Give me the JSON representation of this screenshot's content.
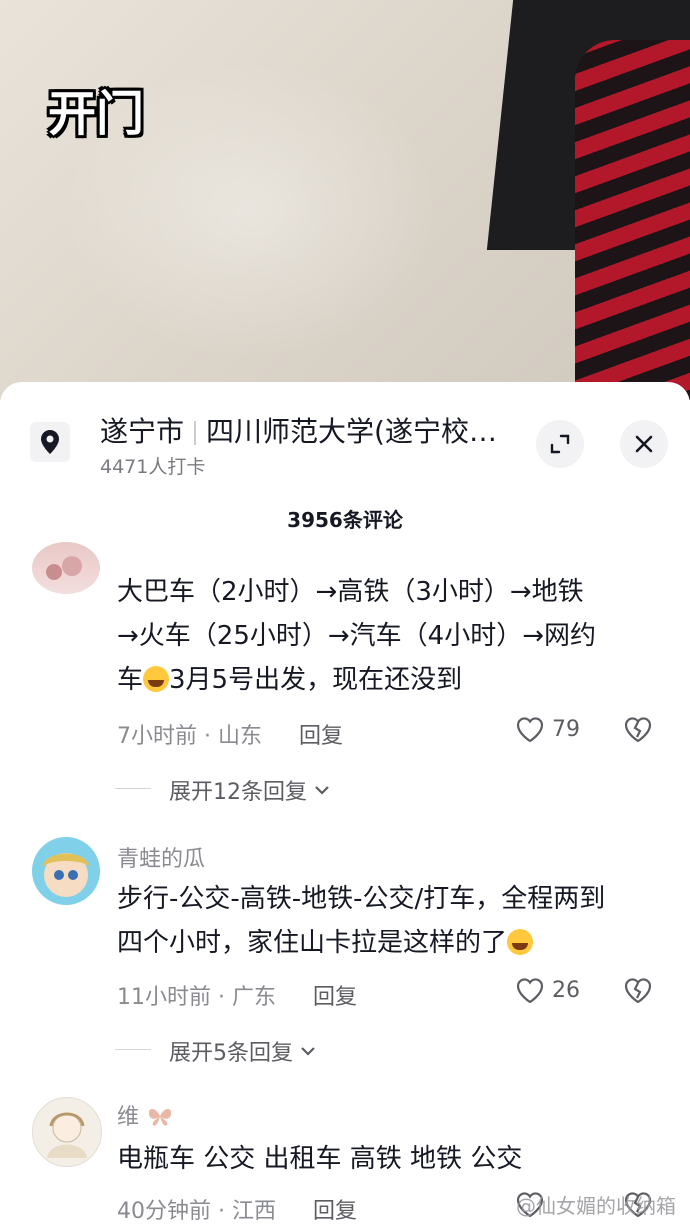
{
  "video": {
    "caption": "开门"
  },
  "location": {
    "city": "遂宁市",
    "place": "四川师范大学(遂宁校…",
    "checkins": "4471人打卡"
  },
  "comments_count": "3956条评论",
  "comments": [
    {
      "username": "",
      "text_line1": "大巴车（2小时）→高铁（3小时）→地铁",
      "text_line2": "→火车（25小时）→汽车（4小时）→网约",
      "text_line3a": "车",
      "text_line3b": "3月5号出发，现在还没到",
      "time_loc": "7小时前 · 山东",
      "reply": "回复",
      "likes": "79",
      "expand": "展开12条回复"
    },
    {
      "username": "青蛙的瓜",
      "text_line1": "步行-公交-高铁-地铁-公交/打车，全程两到",
      "text_line2": "四个小时，家住山卡拉是这样的了",
      "time_loc": "11小时前 · 广东",
      "reply": "回复",
      "likes": "26",
      "expand": "展开5条回复"
    },
    {
      "username": "维",
      "text_line1": "电瓶车 公交 出租车 高铁 地铁 公交",
      "time_loc": "40分钟前 · 江西",
      "reply": "回复",
      "likes": ""
    }
  ],
  "watermark": "@仙女媚的收纳箱",
  "colors": {
    "text": "#161823",
    "secondary": "#8a8b91",
    "icon_bg": "#f2f2f4"
  }
}
